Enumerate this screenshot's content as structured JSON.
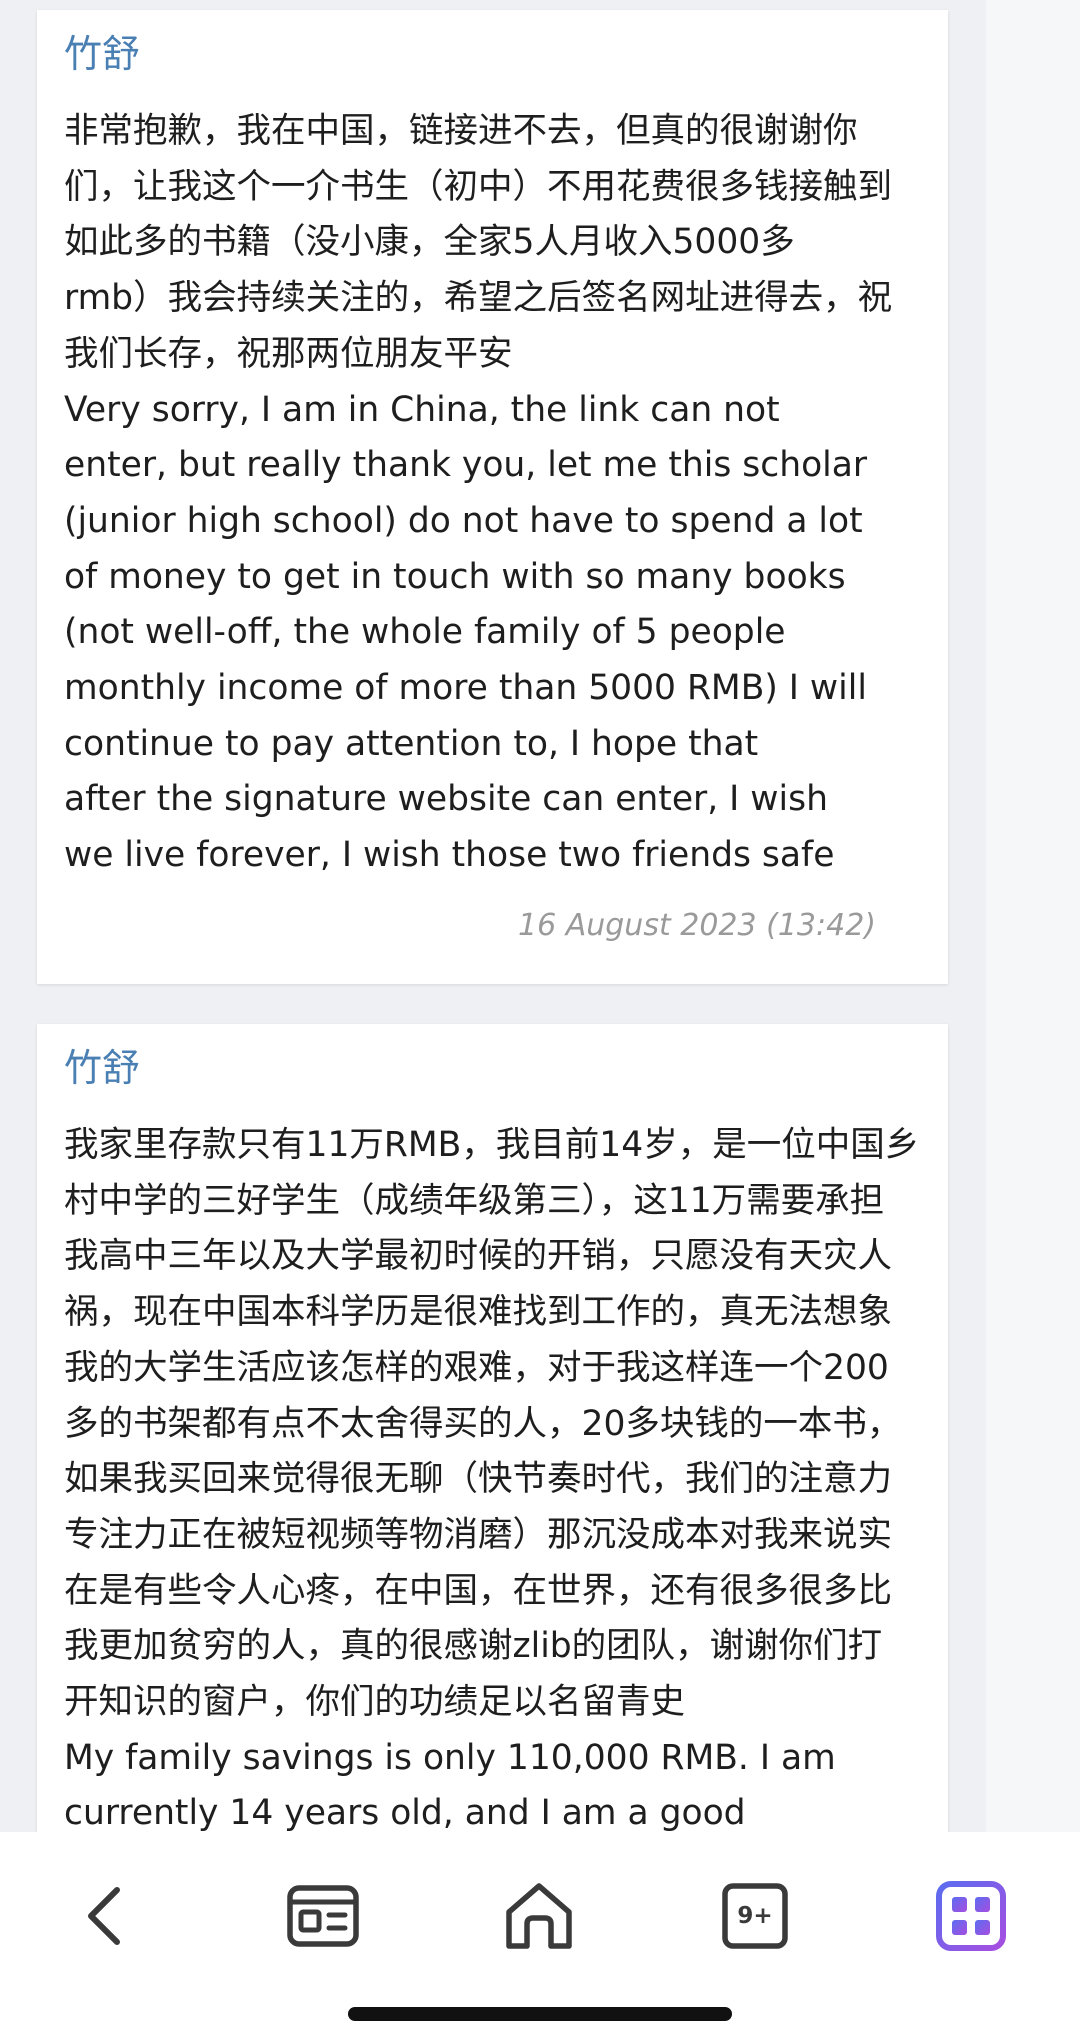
{
  "comments": [
    {
      "author": "竹舒",
      "text": "非常抱歉，我在中国，链接进不去，但真的很谢谢你\n们，让我这个一介书生（初中）不用花费很多钱接触到\n如此多的书籍（没小康，全家5人月收入5000多\nrmb）我会持续关注的，希望之后签名网址进得去，祝\n我们长存，祝那两位朋友平安\nVery sorry, I am in China, the link can not\nenter, but really thank you, let me this scholar\n(junior high school) do not have to spend a lot\nof money to get in touch with so many books\n(not well-off, the whole family of 5 people\nmonthly income of more than 5000 RMB) I will\ncontinue to pay attention to, I hope that\nafter the signature website can enter, I wish\nwe live forever, I wish those two friends safe",
      "date": "16 August 2023 (13:42)"
    },
    {
      "author": "竹舒",
      "text": "我家里存款只有11万RMB，我目前14岁，是一位中国乡\n村中学的三好学生（成绩年级第三），这11万需要承担\n我高中三年以及大学最初时候的开销，只愿没有天灾人\n祸，现在中国本科学历是很难找到工作的，真无法想象\n我的大学生活应该怎样的艰难，对于我这样连一个200\n多的书架都有点不太舍得买的人，20多块钱的一本书，\n如果我买回来觉得很无聊（快节奏时代，我们的注意力\n专注力正在被短视频等物消磨）那沉没成本对我来说实\n在是有些令人心疼，在中国，在世界，还有很多很多比\n我更加贫穷的人，真的很感谢zlib的团队，谢谢你们打\n开知识的窗户，你们的功绩足以名留青史\nMy family savings is only 110,000 RMB. I am\ncurrently 14 years old, and I am a good"
    }
  ],
  "bottom_nav": {
    "tabs_count": "9+",
    "icons": [
      "back-arrow-icon",
      "news-icon",
      "home-icon",
      "tabs-icon",
      "apps-grid-icon"
    ],
    "accent_gradient": [
      "#5b6cf0",
      "#a64ee0"
    ]
  }
}
